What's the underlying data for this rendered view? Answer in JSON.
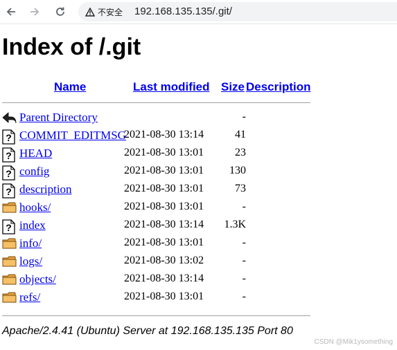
{
  "browser": {
    "security_label": "不安全",
    "url": "192.168.135.135/.git/",
    "icons": [
      "back-arrow-icon",
      "forward-arrow-icon",
      "reload-icon",
      "warning-icon"
    ]
  },
  "page": {
    "title": "Index of /.git",
    "headers": {
      "name": "Name",
      "last_modified": "Last modified",
      "size": "Size",
      "description": "Description"
    },
    "rows": [
      {
        "name": "Parent Directory",
        "modified": "",
        "size": "-",
        "icon": "back-folder-icon"
      },
      {
        "name": "COMMIT_EDITMSG",
        "modified": "2021-08-30 13:14",
        "size": "41",
        "icon": "unknown-file-icon"
      },
      {
        "name": "HEAD",
        "modified": "2021-08-30 13:01",
        "size": "23",
        "icon": "unknown-file-icon"
      },
      {
        "name": "config",
        "modified": "2021-08-30 13:01",
        "size": "130",
        "icon": "unknown-file-icon"
      },
      {
        "name": "description",
        "modified": "2021-08-30 13:01",
        "size": "73",
        "icon": "unknown-file-icon"
      },
      {
        "name": "hooks/",
        "modified": "2021-08-30 13:01",
        "size": "-",
        "icon": "folder-icon"
      },
      {
        "name": "index",
        "modified": "2021-08-30 13:14",
        "size": "1.3K",
        "icon": "unknown-file-icon"
      },
      {
        "name": "info/",
        "modified": "2021-08-30 13:01",
        "size": "-",
        "icon": "folder-icon"
      },
      {
        "name": "logs/",
        "modified": "2021-08-30 13:02",
        "size": "-",
        "icon": "folder-icon"
      },
      {
        "name": "objects/",
        "modified": "2021-08-30 13:14",
        "size": "-",
        "icon": "folder-icon"
      },
      {
        "name": "refs/",
        "modified": "2021-08-30 13:01",
        "size": "-",
        "icon": "folder-icon"
      }
    ],
    "footer": "Apache/2.4.41 (Ubuntu) Server at 192.168.135.135 Port 80"
  },
  "watermark": "CSDN @Mik1ysomething"
}
